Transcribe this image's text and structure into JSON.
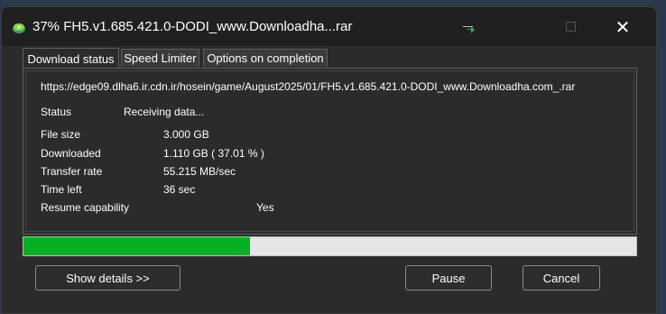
{
  "window": {
    "title": "37% FH5.v1.685.421.0-DODI_www.Downloadha...rar",
    "close_glyph": "✕"
  },
  "tabs": [
    {
      "label": "Download status"
    },
    {
      "label": "Speed Limiter"
    },
    {
      "label": "Options on completion"
    }
  ],
  "download": {
    "url": "https://edge09.dlha6.ir.cdn.ir/hosein/game/August2025/01/FH5.v1.685.421.0-DODI_www.Downloadha.com_.rar",
    "status_label": "Status",
    "status_value": "Receiving data...",
    "file_size_label": "File size",
    "file_size_value": "3.000  GB",
    "downloaded_label": "Downloaded",
    "downloaded_value": "1.110  GB  ( 37.01 % )",
    "transfer_rate_label": "Transfer rate",
    "transfer_rate_value": "55.215  MB/sec",
    "time_left_label": "Time left",
    "time_left_value": "36 sec",
    "resume_label": "Resume capability",
    "resume_value": "Yes"
  },
  "progress": {
    "percent": 37.01,
    "fill_color": "#06b025"
  },
  "buttons": {
    "details": "Show details >>",
    "pause": "Pause",
    "cancel": "Cancel"
  },
  "icons": {
    "app": "download-manager-icon",
    "minimize": "minimize-icon",
    "maximize": "maximize-icon",
    "close": "close-icon"
  }
}
